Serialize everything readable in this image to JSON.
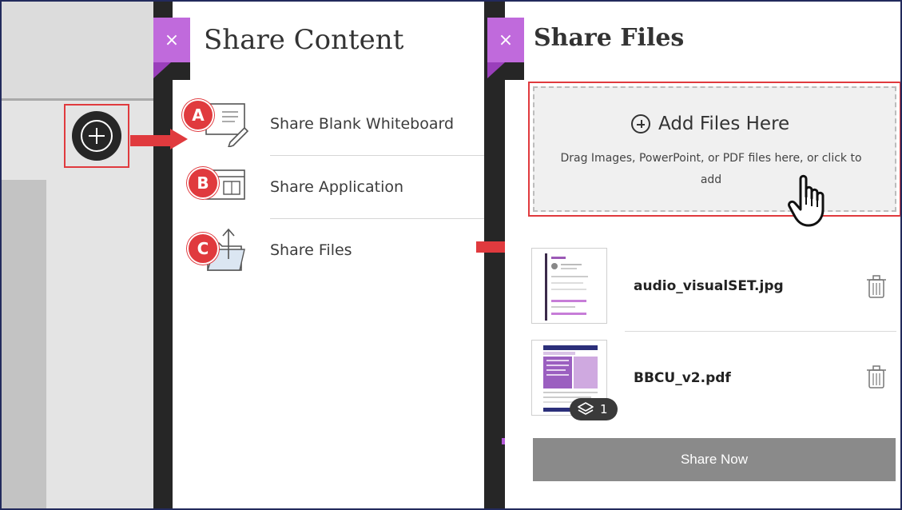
{
  "share_content": {
    "title": "Share Content",
    "items": [
      {
        "badge": "A",
        "label": "Share Blank Whiteboard",
        "icon": "whiteboard-icon"
      },
      {
        "badge": "B",
        "label": "Share Application",
        "icon": "application-window-icon"
      },
      {
        "badge": "C",
        "label": "Share Files",
        "icon": "folder-upload-icon"
      }
    ]
  },
  "share_files": {
    "title": "Share Files",
    "drop_zone": {
      "heading": "Add Files Here",
      "hint": "Drag Images, PowerPoint, or PDF files here, or click to add"
    },
    "files": [
      {
        "name": "audio_visualSET.jpg"
      },
      {
        "name": "BBCU_v2.pdf",
        "page_count": "1"
      }
    ],
    "share_button": "Share Now"
  },
  "close_label": "×",
  "colors": {
    "accent_purple": "#c06adc",
    "callout_red": "#e03a3e",
    "dark": "#262626",
    "button_gray": "#8a8a8a"
  }
}
